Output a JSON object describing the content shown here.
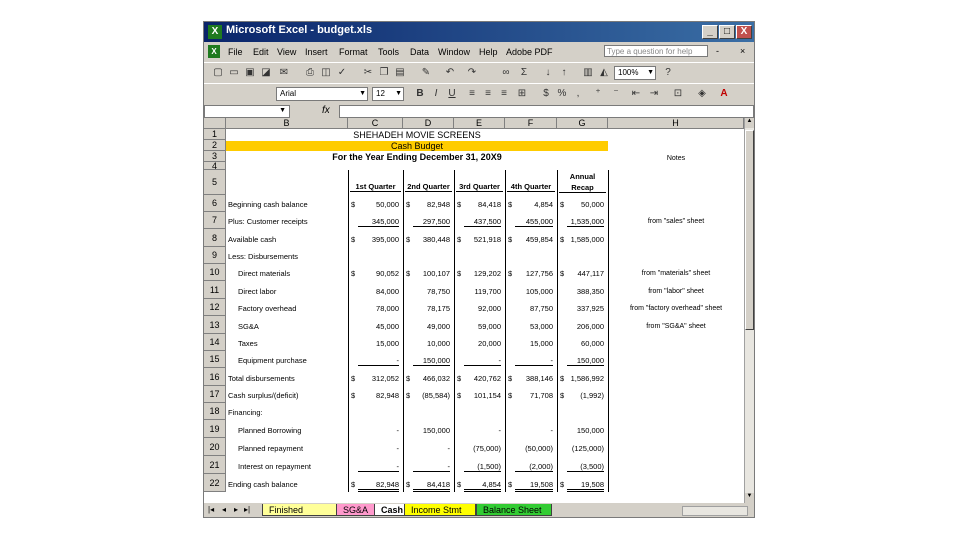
{
  "window": {
    "app_icon": "excel-icon",
    "title": "Microsoft Excel - budget.xls",
    "min": "_",
    "max": "□",
    "close": "X"
  },
  "menu": {
    "items": [
      "File",
      "Edit",
      "View",
      "Insert",
      "Format",
      "Tools",
      "Data",
      "Window",
      "Help",
      "Adobe PDF"
    ],
    "ask_placeholder": "Type a question for help",
    "doc_controls": [
      "-",
      "×"
    ]
  },
  "toolbar": {
    "zoom": "100%",
    "font": "Arial",
    "size": "12"
  },
  "formula_bar": {
    "cell_ref": "",
    "fx": "fx"
  },
  "columns": [
    "B",
    "C",
    "D",
    "E",
    "F",
    "G",
    "H"
  ],
  "rows": [
    "1",
    "2",
    "3",
    "4",
    "5",
    "6",
    "7",
    "8",
    "9",
    "10",
    "11",
    "12",
    "13",
    "14",
    "15",
    "16",
    "17",
    "18",
    "19",
    "20",
    "21",
    "22"
  ],
  "sheet": {
    "company": "SHEHADEH MOVIE SCREENS",
    "title": "Cash Budget",
    "period": "For the Year Ending December 31, 20X9",
    "notes_header": "Notes",
    "quarters": [
      "1st Quarter",
      "2nd Quarter",
      "3rd Quarter",
      "4th Quarter"
    ],
    "annual": [
      "Annual",
      "Recap"
    ],
    "lines": [
      {
        "row": "6",
        "label": "Beginning cash balance",
        "c": "50,000",
        "d": "82,948",
        "e": "84,418",
        "f": "4,854",
        "g": "50,000",
        "cs": "$",
        "ds": "$",
        "es": "$",
        "fs": "$",
        "gs": "$",
        "note": ""
      },
      {
        "row": "7",
        "label": "Plus: Customer receipts",
        "c": "345,000",
        "d": "297,500",
        "e": "437,500",
        "f": "455,000",
        "g": "1,535,000",
        "cs": "",
        "ds": "",
        "es": "",
        "fs": "",
        "gs": "",
        "note": "from \"sales\" sheet"
      },
      {
        "row": "8",
        "label": "Available cash",
        "c": "395,000",
        "d": "380,448",
        "e": "521,918",
        "f": "459,854",
        "g": "1,585,000",
        "cs": "$",
        "ds": "$",
        "es": "$",
        "fs": "$",
        "gs": "$",
        "note": ""
      },
      {
        "row": "9",
        "label": "Less:  Disbursements",
        "c": "",
        "d": "",
        "e": "",
        "f": "",
        "g": "",
        "cs": "",
        "ds": "",
        "es": "",
        "fs": "",
        "gs": "",
        "note": ""
      },
      {
        "row": "10",
        "label": "Direct materials",
        "c": "90,052",
        "d": "100,107",
        "e": "129,202",
        "f": "127,756",
        "g": "447,117",
        "cs": "$",
        "ds": "$",
        "es": "$",
        "fs": "$",
        "gs": "$",
        "note": "from \"materials\" sheet"
      },
      {
        "row": "11",
        "label": "Direct labor",
        "c": "84,000",
        "d": "78,750",
        "e": "119,700",
        "f": "105,000",
        "g": "388,350",
        "cs": "",
        "ds": "",
        "es": "",
        "fs": "",
        "gs": "",
        "note": "from \"labor\" sheet"
      },
      {
        "row": "12",
        "label": "Factory overhead",
        "c": "78,000",
        "d": "78,175",
        "e": "92,000",
        "f": "87,750",
        "g": "337,925",
        "cs": "",
        "ds": "",
        "es": "",
        "fs": "",
        "gs": "",
        "note": "from \"factory overhead\" sheet"
      },
      {
        "row": "13",
        "label": "SG&A",
        "c": "45,000",
        "d": "49,000",
        "e": "59,000",
        "f": "53,000",
        "g": "206,000",
        "cs": "",
        "ds": "",
        "es": "",
        "fs": "",
        "gs": "",
        "note": "from \"SG&A\" sheet"
      },
      {
        "row": "14",
        "label": "Taxes",
        "c": "15,000",
        "d": "10,000",
        "e": "20,000",
        "f": "15,000",
        "g": "60,000",
        "cs": "",
        "ds": "",
        "es": "",
        "fs": "",
        "gs": "",
        "note": ""
      },
      {
        "row": "15",
        "label": "Equipment purchase",
        "c": "-",
        "d": "150,000",
        "e": "-",
        "f": "-",
        "g": "150,000",
        "cs": "",
        "ds": "",
        "es": "",
        "fs": "",
        "gs": "",
        "note": ""
      },
      {
        "row": "16",
        "label": "Total disbursements",
        "c": "312,052",
        "d": "466,032",
        "e": "420,762",
        "f": "388,146",
        "g": "1,586,992",
        "cs": "$",
        "ds": "$",
        "es": "$",
        "fs": "$",
        "gs": "$",
        "note": ""
      },
      {
        "row": "17",
        "label": "Cash surplus/(deficit)",
        "c": "82,948",
        "d": "(85,584)",
        "e": "101,154",
        "f": "71,708",
        "g": "(1,992)",
        "cs": "$",
        "ds": "$",
        "es": "$",
        "fs": "$",
        "gs": "$",
        "note": ""
      },
      {
        "row": "18",
        "label": "Financing:",
        "c": "",
        "d": "",
        "e": "",
        "f": "",
        "g": "",
        "cs": "",
        "ds": "",
        "es": "",
        "fs": "",
        "gs": "",
        "note": ""
      },
      {
        "row": "19",
        "label": "Planned Borrowing",
        "c": "-",
        "d": "150,000",
        "e": "-",
        "f": "-",
        "g": "150,000",
        "cs": "",
        "ds": "",
        "es": "",
        "fs": "",
        "gs": "",
        "note": ""
      },
      {
        "row": "20",
        "label": "Planned repayment",
        "c": "-",
        "d": "-",
        "e": "(75,000)",
        "f": "(50,000)",
        "g": "(125,000)",
        "cs": "",
        "ds": "",
        "es": "",
        "fs": "",
        "gs": "",
        "note": ""
      },
      {
        "row": "21",
        "label": "Interest on repayment",
        "c": "-",
        "d": "-",
        "e": "(1,500)",
        "f": "(2,000)",
        "g": "(3,500)",
        "cs": "",
        "ds": "",
        "es": "",
        "fs": "",
        "gs": "",
        "note": ""
      },
      {
        "row": "22",
        "label": "Ending cash balance",
        "c": "82,948",
        "d": "84,418",
        "e": "4,854",
        "f": "19,508",
        "g": "19,508",
        "cs": "$",
        "ds": "$",
        "es": "$",
        "fs": "$",
        "gs": "$",
        "note": ""
      }
    ]
  },
  "tabs": [
    {
      "label": "Finished Goods",
      "color": "#ffff99"
    },
    {
      "label": "SG&A",
      "color": "#ff99cc"
    },
    {
      "label": "Cash",
      "color": "#ffffff"
    },
    {
      "label": "Income Stmt",
      "color": "#ffff00"
    },
    {
      "label": "Balance Sheet",
      "color": "#33cc33"
    }
  ],
  "colors": {
    "accent": "#ffcc00",
    "title_bar": "#0a246a"
  }
}
